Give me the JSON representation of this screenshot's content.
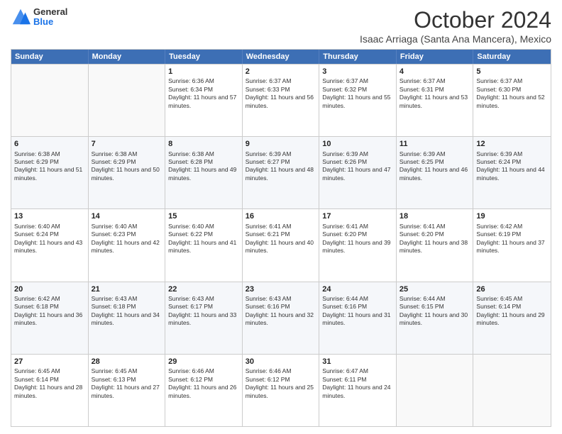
{
  "header": {
    "logo": {
      "line1": "General",
      "line2": "Blue"
    },
    "title": "October 2024",
    "subtitle": "Isaac Arriaga (Santa Ana Mancera), Mexico"
  },
  "calendar": {
    "days_of_week": [
      "Sunday",
      "Monday",
      "Tuesday",
      "Wednesday",
      "Thursday",
      "Friday",
      "Saturday"
    ],
    "rows": [
      [
        {
          "day": "",
          "sunrise": "",
          "sunset": "",
          "daylight": ""
        },
        {
          "day": "",
          "sunrise": "",
          "sunset": "",
          "daylight": ""
        },
        {
          "day": "1",
          "sunrise": "Sunrise: 6:36 AM",
          "sunset": "Sunset: 6:34 PM",
          "daylight": "Daylight: 11 hours and 57 minutes."
        },
        {
          "day": "2",
          "sunrise": "Sunrise: 6:37 AM",
          "sunset": "Sunset: 6:33 PM",
          "daylight": "Daylight: 11 hours and 56 minutes."
        },
        {
          "day": "3",
          "sunrise": "Sunrise: 6:37 AM",
          "sunset": "Sunset: 6:32 PM",
          "daylight": "Daylight: 11 hours and 55 minutes."
        },
        {
          "day": "4",
          "sunrise": "Sunrise: 6:37 AM",
          "sunset": "Sunset: 6:31 PM",
          "daylight": "Daylight: 11 hours and 53 minutes."
        },
        {
          "day": "5",
          "sunrise": "Sunrise: 6:37 AM",
          "sunset": "Sunset: 6:30 PM",
          "daylight": "Daylight: 11 hours and 52 minutes."
        }
      ],
      [
        {
          "day": "6",
          "sunrise": "Sunrise: 6:38 AM",
          "sunset": "Sunset: 6:29 PM",
          "daylight": "Daylight: 11 hours and 51 minutes."
        },
        {
          "day": "7",
          "sunrise": "Sunrise: 6:38 AM",
          "sunset": "Sunset: 6:29 PM",
          "daylight": "Daylight: 11 hours and 50 minutes."
        },
        {
          "day": "8",
          "sunrise": "Sunrise: 6:38 AM",
          "sunset": "Sunset: 6:28 PM",
          "daylight": "Daylight: 11 hours and 49 minutes."
        },
        {
          "day": "9",
          "sunrise": "Sunrise: 6:39 AM",
          "sunset": "Sunset: 6:27 PM",
          "daylight": "Daylight: 11 hours and 48 minutes."
        },
        {
          "day": "10",
          "sunrise": "Sunrise: 6:39 AM",
          "sunset": "Sunset: 6:26 PM",
          "daylight": "Daylight: 11 hours and 47 minutes."
        },
        {
          "day": "11",
          "sunrise": "Sunrise: 6:39 AM",
          "sunset": "Sunset: 6:25 PM",
          "daylight": "Daylight: 11 hours and 46 minutes."
        },
        {
          "day": "12",
          "sunrise": "Sunrise: 6:39 AM",
          "sunset": "Sunset: 6:24 PM",
          "daylight": "Daylight: 11 hours and 44 minutes."
        }
      ],
      [
        {
          "day": "13",
          "sunrise": "Sunrise: 6:40 AM",
          "sunset": "Sunset: 6:24 PM",
          "daylight": "Daylight: 11 hours and 43 minutes."
        },
        {
          "day": "14",
          "sunrise": "Sunrise: 6:40 AM",
          "sunset": "Sunset: 6:23 PM",
          "daylight": "Daylight: 11 hours and 42 minutes."
        },
        {
          "day": "15",
          "sunrise": "Sunrise: 6:40 AM",
          "sunset": "Sunset: 6:22 PM",
          "daylight": "Daylight: 11 hours and 41 minutes."
        },
        {
          "day": "16",
          "sunrise": "Sunrise: 6:41 AM",
          "sunset": "Sunset: 6:21 PM",
          "daylight": "Daylight: 11 hours and 40 minutes."
        },
        {
          "day": "17",
          "sunrise": "Sunrise: 6:41 AM",
          "sunset": "Sunset: 6:20 PM",
          "daylight": "Daylight: 11 hours and 39 minutes."
        },
        {
          "day": "18",
          "sunrise": "Sunrise: 6:41 AM",
          "sunset": "Sunset: 6:20 PM",
          "daylight": "Daylight: 11 hours and 38 minutes."
        },
        {
          "day": "19",
          "sunrise": "Sunrise: 6:42 AM",
          "sunset": "Sunset: 6:19 PM",
          "daylight": "Daylight: 11 hours and 37 minutes."
        }
      ],
      [
        {
          "day": "20",
          "sunrise": "Sunrise: 6:42 AM",
          "sunset": "Sunset: 6:18 PM",
          "daylight": "Daylight: 11 hours and 36 minutes."
        },
        {
          "day": "21",
          "sunrise": "Sunrise: 6:43 AM",
          "sunset": "Sunset: 6:18 PM",
          "daylight": "Daylight: 11 hours and 34 minutes."
        },
        {
          "day": "22",
          "sunrise": "Sunrise: 6:43 AM",
          "sunset": "Sunset: 6:17 PM",
          "daylight": "Daylight: 11 hours and 33 minutes."
        },
        {
          "day": "23",
          "sunrise": "Sunrise: 6:43 AM",
          "sunset": "Sunset: 6:16 PM",
          "daylight": "Daylight: 11 hours and 32 minutes."
        },
        {
          "day": "24",
          "sunrise": "Sunrise: 6:44 AM",
          "sunset": "Sunset: 6:16 PM",
          "daylight": "Daylight: 11 hours and 31 minutes."
        },
        {
          "day": "25",
          "sunrise": "Sunrise: 6:44 AM",
          "sunset": "Sunset: 6:15 PM",
          "daylight": "Daylight: 11 hours and 30 minutes."
        },
        {
          "day": "26",
          "sunrise": "Sunrise: 6:45 AM",
          "sunset": "Sunset: 6:14 PM",
          "daylight": "Daylight: 11 hours and 29 minutes."
        }
      ],
      [
        {
          "day": "27",
          "sunrise": "Sunrise: 6:45 AM",
          "sunset": "Sunset: 6:14 PM",
          "daylight": "Daylight: 11 hours and 28 minutes."
        },
        {
          "day": "28",
          "sunrise": "Sunrise: 6:45 AM",
          "sunset": "Sunset: 6:13 PM",
          "daylight": "Daylight: 11 hours and 27 minutes."
        },
        {
          "day": "29",
          "sunrise": "Sunrise: 6:46 AM",
          "sunset": "Sunset: 6:12 PM",
          "daylight": "Daylight: 11 hours and 26 minutes."
        },
        {
          "day": "30",
          "sunrise": "Sunrise: 6:46 AM",
          "sunset": "Sunset: 6:12 PM",
          "daylight": "Daylight: 11 hours and 25 minutes."
        },
        {
          "day": "31",
          "sunrise": "Sunrise: 6:47 AM",
          "sunset": "Sunset: 6:11 PM",
          "daylight": "Daylight: 11 hours and 24 minutes."
        },
        {
          "day": "",
          "sunrise": "",
          "sunset": "",
          "daylight": ""
        },
        {
          "day": "",
          "sunrise": "",
          "sunset": "",
          "daylight": ""
        }
      ]
    ]
  }
}
